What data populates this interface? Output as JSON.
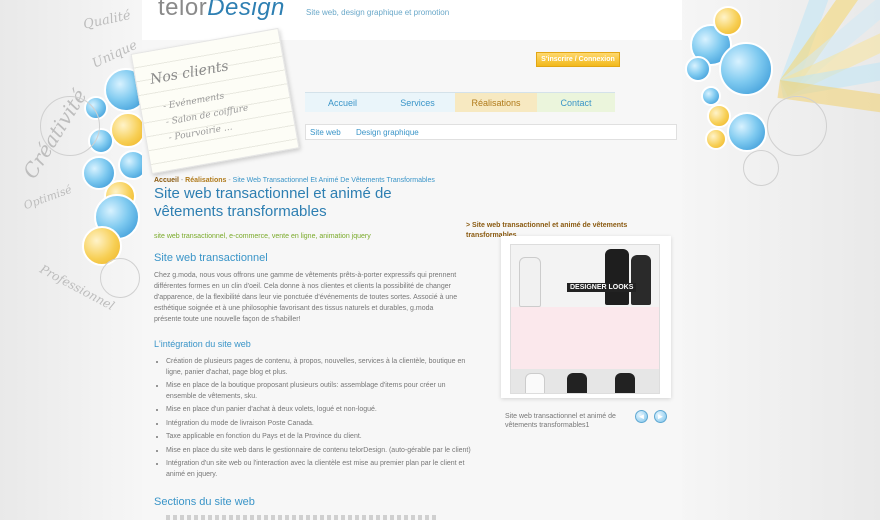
{
  "brand": {
    "logo_part1": "telor",
    "logo_part2": "Design",
    "tagline": "Site web, design graphique et promotion"
  },
  "auth": {
    "signin_label": "S'inscrire / Connexion"
  },
  "decor": {
    "left_words": [
      "Qualité",
      "Unique",
      "Créativité",
      "Optimisé",
      "Professionnel"
    ],
    "colors": {
      "accent_blue": "#2e7fb2",
      "accent_yellow": "#f2b91c"
    }
  },
  "note": {
    "title": "Nos clients",
    "items": [
      "- Evénements",
      "- Salon de coiffure",
      "- Pourvoirie ..."
    ]
  },
  "nav": {
    "tabs": [
      "Accueil",
      "Services",
      "Réalisations",
      "Contact"
    ],
    "active": "Réalisations"
  },
  "subnav": {
    "items": [
      "Site web",
      "Design graphique"
    ]
  },
  "breadcrumb": {
    "home": "Accueil",
    "section": "Réalisations",
    "sep": "-",
    "current": "Site Web Transactionnel Et Animé De Vêtements Transformables"
  },
  "article": {
    "title": "Site web transactionnel et animé de vêtements transformables",
    "tags": "site web transactionnel, e-commerce, vente en ligne, animation jquery",
    "section1_title": "Site web transactionnel",
    "section1_text": "Chez g.moda, nous vous offrons une gamme de vêtements prêts-à-porter expressifs qui prennent différentes formes en un clin d'oeil. Cela donne à nos clientes et clients la possibilité de changer d'apparence, de la flexibilité dans leur vie ponctuée d'événements de toutes sortes. Associé à une esthétique soignée et à une philosophie favorisant des tissus naturels et durables, g.moda présente toute une nouvelle façon de s'habiller!",
    "section2_title": "L'intégration du site web",
    "bullets": [
      "Création de plusieurs pages de contenu, à propos, nouvelles, services à la clientèle, boutique en ligne, panier d'achat, page blog et plus.",
      "Mise en place de la boutique proposant plusieurs outils: assemblage d'items pour créer un ensemble de vêtements, sku.",
      "Mise en place d'un panier d'achat à deux volets, logué et non-logué.",
      "Intégration du mode de livraison Poste Canada.",
      "Taxe applicable en fonction du Pays et de la Province du client.",
      "Mise en place du site web dans le gestionnaire de contenu telorDesign. (auto-gérable par le client)",
      "Intégration d'un site web ou l'interaction avec la clientèle est mise au premier plan par le client et animé en jquery."
    ],
    "section3_title": "Sections du site web"
  },
  "gallery": {
    "title": "> Site web transactionnel et animé de vêtements transformables",
    "image_text": "DESIGNER LOOKS",
    "caption": "Site web transactionnel et animé de vêtements transformables1",
    "prev_icon": "◄",
    "next_icon": "►"
  }
}
